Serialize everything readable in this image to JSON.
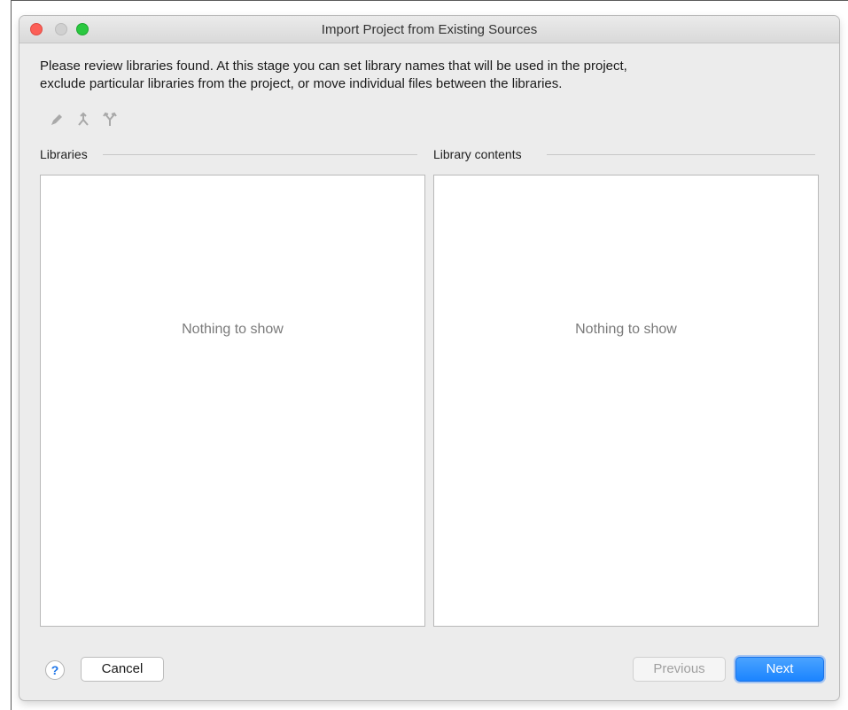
{
  "window": {
    "title": "Import Project from Existing Sources"
  },
  "description": {
    "line1": "Please review libraries found. At this stage you can set library names that will be used in the project,",
    "line2": "exclude particular libraries from the project, or move individual files between the libraries."
  },
  "toolbar": {
    "icons": [
      "rename-icon",
      "merge-icon",
      "split-icon"
    ]
  },
  "libraries": {
    "label": "Libraries",
    "empty_text": "Nothing to show"
  },
  "library_contents": {
    "label": "Library contents",
    "empty_text": "Nothing to show"
  },
  "footer": {
    "help_label": "?",
    "cancel_label": "Cancel",
    "previous_label": "Previous",
    "next_label": "Next"
  },
  "colors": {
    "accent": "#1b84ff",
    "close": "#fc5f57",
    "zoom": "#2ac840"
  }
}
